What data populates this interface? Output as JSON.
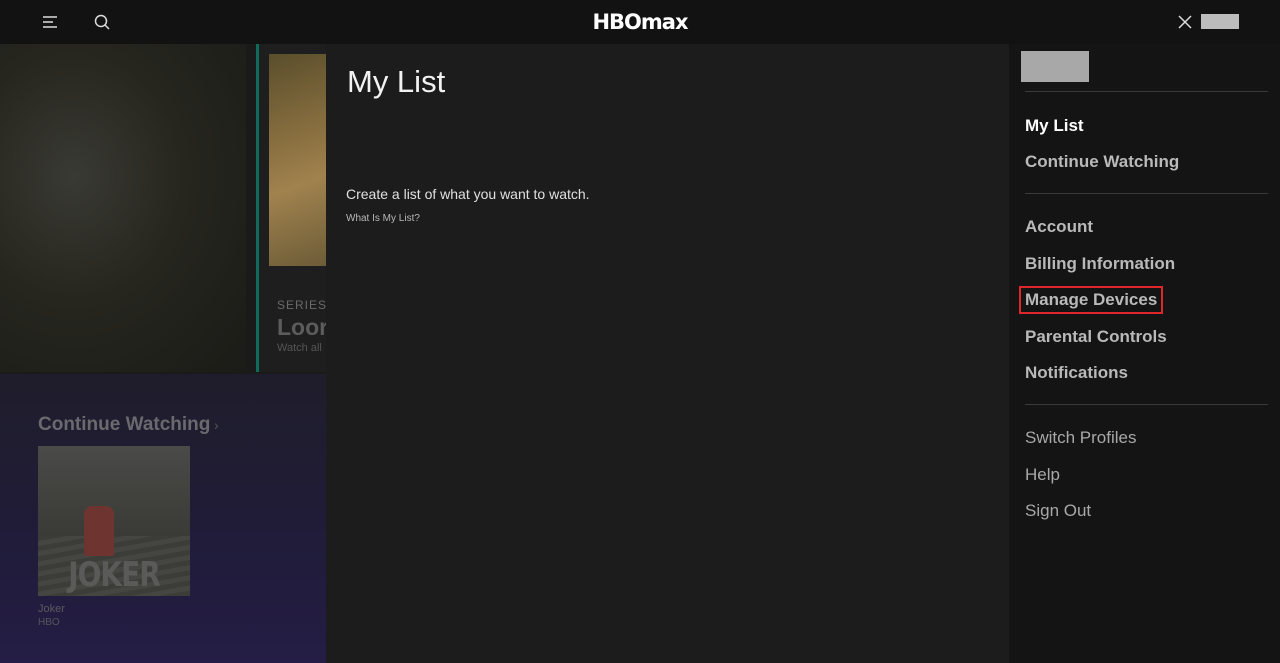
{
  "header": {
    "logo_text": "HBOmax",
    "menu_icon": "hamburger-menu-icon",
    "search_icon": "search-icon",
    "close_icon": "close-icon"
  },
  "background": {
    "hero_card": {
      "label": "SERIES",
      "title": "Loor",
      "subtitle": "Watch all"
    },
    "continue_watching": {
      "title": "Continue Watching",
      "chevron": "›",
      "items": [
        {
          "poster_text": "JOKER",
          "title": "Joker",
          "network": "HBO"
        }
      ]
    }
  },
  "my_list": {
    "title": "My List",
    "empty_message": "Create a list of what you want to watch.",
    "help_link": "What Is My List?"
  },
  "side_menu": {
    "primary": [
      {
        "label": "My List"
      },
      {
        "label": "Continue Watching"
      }
    ],
    "account": [
      {
        "label": "Account"
      },
      {
        "label": "Billing Information"
      },
      {
        "label": "Manage Devices"
      },
      {
        "label": "Parental Controls"
      },
      {
        "label": "Notifications"
      }
    ],
    "secondary": [
      {
        "label": "Switch Profiles"
      },
      {
        "label": "Help"
      },
      {
        "label": "Sign Out"
      }
    ]
  },
  "colors": {
    "highlight_outline": "#e0262b",
    "panel_bg": "#1c1c1c",
    "side_bg": "#141414"
  }
}
